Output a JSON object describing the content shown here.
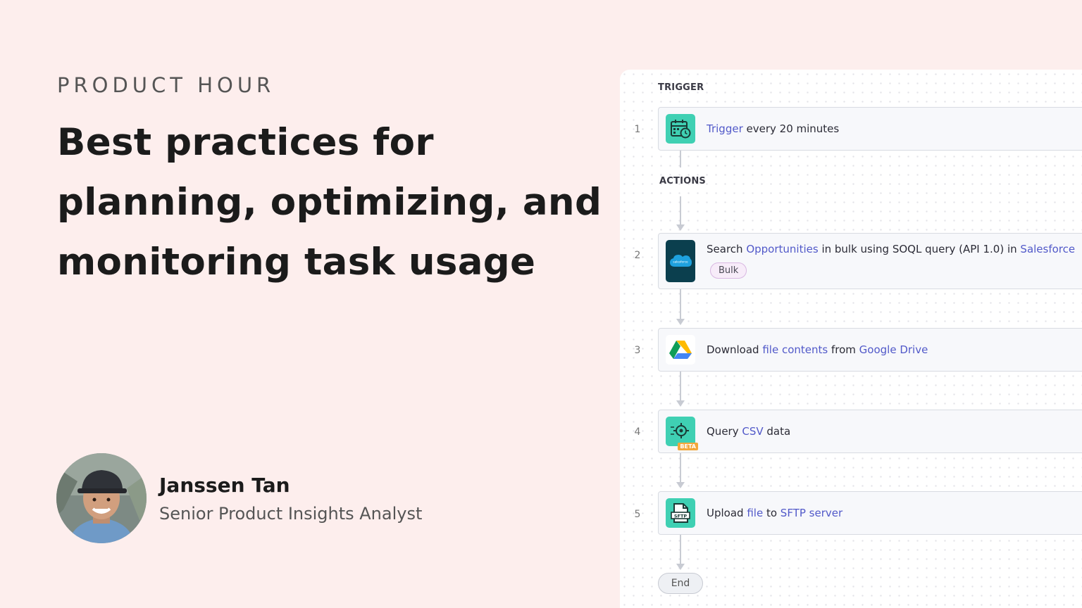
{
  "hero": {
    "eyebrow": "PRODUCT HOUR",
    "headline_line1": "Best practices for",
    "headline_line2": "planning, optimizing, and",
    "headline_line3": "monitoring task usage"
  },
  "presenter": {
    "name": "Janssen Tan",
    "role": "Senior Product Insights Analyst",
    "avatar_icon": "person-photo"
  },
  "workflow": {
    "trigger_label": "TRIGGER",
    "actions_label": "ACTIONS",
    "end_label": "End",
    "steps": [
      {
        "number": "1",
        "icon": "scheduler-clock-icon",
        "icon_color": "#3fd0b3",
        "parts": [
          {
            "text": "Trigger",
            "link": true
          },
          {
            "text": " every 20 minutes",
            "link": false
          }
        ]
      },
      {
        "number": "2",
        "icon": "salesforce-icon",
        "icon_color": "#0b3f4e",
        "parts": [
          {
            "text": "Search ",
            "link": false
          },
          {
            "text": "Opportunities",
            "link": true
          },
          {
            "text": " in bulk using SOQL query (API 1.0) in ",
            "link": false
          },
          {
            "text": "Salesforce",
            "link": true
          }
        ],
        "badge": "Bulk"
      },
      {
        "number": "3",
        "icon": "google-drive-icon",
        "icon_color": "#ffffff",
        "parts": [
          {
            "text": "Download ",
            "link": false
          },
          {
            "text": "file contents",
            "link": true
          },
          {
            "text": " from ",
            "link": false
          },
          {
            "text": "Google Drive",
            "link": true
          }
        ]
      },
      {
        "number": "4",
        "icon": "csv-gear-icon",
        "icon_color": "#3fd0b3",
        "beta": "BETA",
        "parts": [
          {
            "text": "Query ",
            "link": false
          },
          {
            "text": "CSV",
            "link": true
          },
          {
            "text": " data",
            "link": false
          }
        ]
      },
      {
        "number": "5",
        "icon": "sftp-icon",
        "icon_color": "#3fd0b3",
        "parts": [
          {
            "text": "Upload ",
            "link": false
          },
          {
            "text": "file",
            "link": true
          },
          {
            "text": " to ",
            "link": false
          },
          {
            "text": "SFTP server",
            "link": true
          }
        ]
      }
    ]
  },
  "colors": {
    "background": "#fdeeed",
    "link": "#5159c9",
    "card": "#f7f8fb",
    "teal": "#3fd0b3"
  }
}
